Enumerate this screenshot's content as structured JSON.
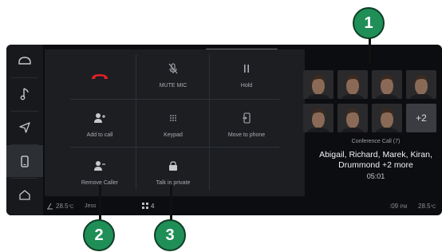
{
  "accent_green": "#1f8f57",
  "hangup_red": "#e21f26",
  "rail": {
    "items": [
      {
        "name": "car-icon"
      },
      {
        "name": "music-note-icon"
      },
      {
        "name": "navigation-icon"
      },
      {
        "name": "phone-icon"
      },
      {
        "name": "home-icon"
      }
    ]
  },
  "controls": {
    "mute_mic": "MUTE MIC",
    "hold": "Hold",
    "add_to_call": "Add to call",
    "keypad": "Keypad",
    "move_to_phone": "Move to phone",
    "remove_caller": "Remove Caller",
    "talk_in_private": "Talk in private"
  },
  "conference": {
    "label": "Conference Call (7)",
    "names_line1": "Abigail, Richard, Marek, Kiran,",
    "names_line2": "Drummond +2 more",
    "timer": "05:01",
    "more_count": "+2"
  },
  "status_bar": {
    "temp_left": "28.5",
    "temp_left_unit": "°C",
    "user": "Jess",
    "grid_count": "4",
    "time": ":09",
    "ampm": "PM",
    "temp_right": "28.5",
    "temp_right_unit": "°C"
  },
  "callouts": [
    "1",
    "2",
    "3"
  ]
}
